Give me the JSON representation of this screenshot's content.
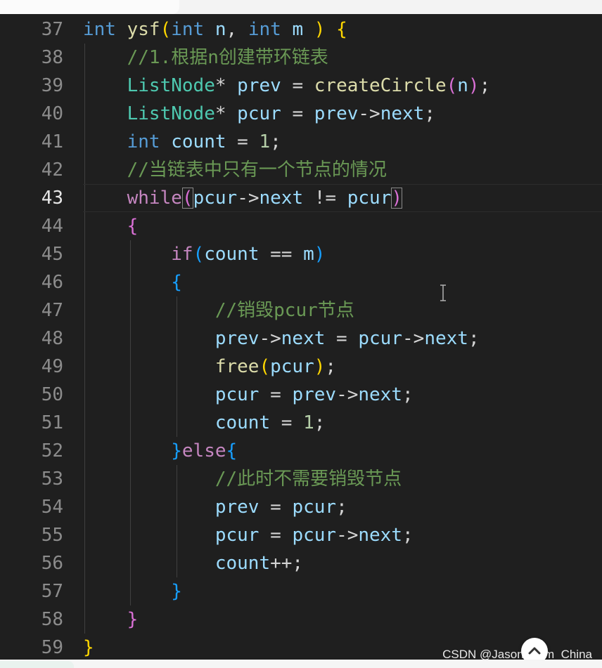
{
  "editor": {
    "lines": [
      {
        "number": "37",
        "tokens": [
          {
            "t": "int",
            "c": "kw"
          },
          {
            "t": " ",
            "c": "pn"
          },
          {
            "t": "ysf",
            "c": "fn"
          },
          {
            "t": "(",
            "c": "b1"
          },
          {
            "t": "int",
            "c": "kw"
          },
          {
            "t": " ",
            "c": "pn"
          },
          {
            "t": "n",
            "c": "var"
          },
          {
            "t": ", ",
            "c": "pn"
          },
          {
            "t": "int",
            "c": "kw"
          },
          {
            "t": " ",
            "c": "pn"
          },
          {
            "t": "m",
            "c": "var"
          },
          {
            "t": " ",
            "c": "pn"
          },
          {
            "t": ")",
            "c": "b1"
          },
          {
            "t": " ",
            "c": "pn"
          },
          {
            "t": "{",
            "c": "b1"
          }
        ]
      },
      {
        "number": "38",
        "tokens": [
          {
            "t": "    ",
            "c": "pn"
          },
          {
            "t": "//1.根据n创建带环链表",
            "c": "cmt"
          }
        ]
      },
      {
        "number": "39",
        "tokens": [
          {
            "t": "    ",
            "c": "pn"
          },
          {
            "t": "ListNode",
            "c": "type"
          },
          {
            "t": "* ",
            "c": "pn"
          },
          {
            "t": "prev",
            "c": "var"
          },
          {
            "t": " = ",
            "c": "pn"
          },
          {
            "t": "createCircle",
            "c": "fn"
          },
          {
            "t": "(",
            "c": "b2"
          },
          {
            "t": "n",
            "c": "var"
          },
          {
            "t": ")",
            "c": "b2"
          },
          {
            "t": ";",
            "c": "pn"
          }
        ]
      },
      {
        "number": "40",
        "tokens": [
          {
            "t": "    ",
            "c": "pn"
          },
          {
            "t": "ListNode",
            "c": "type"
          },
          {
            "t": "* ",
            "c": "pn"
          },
          {
            "t": "pcur",
            "c": "var"
          },
          {
            "t": " = ",
            "c": "pn"
          },
          {
            "t": "prev",
            "c": "var"
          },
          {
            "t": "->",
            "c": "pn"
          },
          {
            "t": "next",
            "c": "var"
          },
          {
            "t": ";",
            "c": "pn"
          }
        ]
      },
      {
        "number": "41",
        "tokens": [
          {
            "t": "    ",
            "c": "pn"
          },
          {
            "t": "int",
            "c": "kw"
          },
          {
            "t": " ",
            "c": "pn"
          },
          {
            "t": "count",
            "c": "var"
          },
          {
            "t": " = ",
            "c": "pn"
          },
          {
            "t": "1",
            "c": "num"
          },
          {
            "t": ";",
            "c": "pn"
          }
        ]
      },
      {
        "number": "42",
        "tokens": [
          {
            "t": "    ",
            "c": "pn"
          },
          {
            "t": "//当链表中只有一个节点的情况",
            "c": "cmt"
          }
        ]
      },
      {
        "number": "43",
        "active": true,
        "tokens": [
          {
            "t": "    ",
            "c": "pn"
          },
          {
            "t": "while",
            "c": "ctl"
          },
          {
            "t": "(",
            "c": "b2",
            "box": true
          },
          {
            "t": "pcur",
            "c": "var"
          },
          {
            "t": "->",
            "c": "pn"
          },
          {
            "t": "next",
            "c": "var"
          },
          {
            "t": " != ",
            "c": "pn"
          },
          {
            "t": "pcur",
            "c": "var"
          },
          {
            "t": ")",
            "c": "b2",
            "box": true
          }
        ]
      },
      {
        "number": "44",
        "tokens": [
          {
            "t": "    ",
            "c": "pn"
          },
          {
            "t": "{",
            "c": "b2"
          }
        ]
      },
      {
        "number": "45",
        "tokens": [
          {
            "t": "        ",
            "c": "pn"
          },
          {
            "t": "if",
            "c": "ctl"
          },
          {
            "t": "(",
            "c": "b3"
          },
          {
            "t": "count",
            "c": "var"
          },
          {
            "t": " == ",
            "c": "pn"
          },
          {
            "t": "m",
            "c": "var"
          },
          {
            "t": ")",
            "c": "b3"
          }
        ]
      },
      {
        "number": "46",
        "tokens": [
          {
            "t": "        ",
            "c": "pn"
          },
          {
            "t": "{",
            "c": "b3"
          }
        ]
      },
      {
        "number": "47",
        "tokens": [
          {
            "t": "            ",
            "c": "pn"
          },
          {
            "t": "//销毁pcur节点",
            "c": "cmt"
          }
        ]
      },
      {
        "number": "48",
        "tokens": [
          {
            "t": "            ",
            "c": "pn"
          },
          {
            "t": "prev",
            "c": "var"
          },
          {
            "t": "->",
            "c": "pn"
          },
          {
            "t": "next",
            "c": "var"
          },
          {
            "t": " = ",
            "c": "pn"
          },
          {
            "t": "pcur",
            "c": "var"
          },
          {
            "t": "->",
            "c": "pn"
          },
          {
            "t": "next",
            "c": "var"
          },
          {
            "t": ";",
            "c": "pn"
          }
        ]
      },
      {
        "number": "49",
        "tokens": [
          {
            "t": "            ",
            "c": "pn"
          },
          {
            "t": "free",
            "c": "fn"
          },
          {
            "t": "(",
            "c": "b1"
          },
          {
            "t": "pcur",
            "c": "var"
          },
          {
            "t": ")",
            "c": "b1"
          },
          {
            "t": ";",
            "c": "pn"
          }
        ]
      },
      {
        "number": "50",
        "tokens": [
          {
            "t": "            ",
            "c": "pn"
          },
          {
            "t": "pcur",
            "c": "var"
          },
          {
            "t": " = ",
            "c": "pn"
          },
          {
            "t": "prev",
            "c": "var"
          },
          {
            "t": "->",
            "c": "pn"
          },
          {
            "t": "next",
            "c": "var"
          },
          {
            "t": ";",
            "c": "pn"
          }
        ]
      },
      {
        "number": "51",
        "tokens": [
          {
            "t": "            ",
            "c": "pn"
          },
          {
            "t": "count",
            "c": "var"
          },
          {
            "t": " = ",
            "c": "pn"
          },
          {
            "t": "1",
            "c": "num"
          },
          {
            "t": ";",
            "c": "pn"
          }
        ]
      },
      {
        "number": "52",
        "tokens": [
          {
            "t": "        ",
            "c": "pn"
          },
          {
            "t": "}",
            "c": "b3"
          },
          {
            "t": "else",
            "c": "ctl"
          },
          {
            "t": "{",
            "c": "b3"
          }
        ]
      },
      {
        "number": "53",
        "tokens": [
          {
            "t": "            ",
            "c": "pn"
          },
          {
            "t": "//此时不需要销毁节点",
            "c": "cmt"
          }
        ]
      },
      {
        "number": "54",
        "tokens": [
          {
            "t": "            ",
            "c": "pn"
          },
          {
            "t": "prev",
            "c": "var"
          },
          {
            "t": " = ",
            "c": "pn"
          },
          {
            "t": "pcur",
            "c": "var"
          },
          {
            "t": ";",
            "c": "pn"
          }
        ]
      },
      {
        "number": "55",
        "tokens": [
          {
            "t": "            ",
            "c": "pn"
          },
          {
            "t": "pcur",
            "c": "var"
          },
          {
            "t": " = ",
            "c": "pn"
          },
          {
            "t": "pcur",
            "c": "var"
          },
          {
            "t": "->",
            "c": "pn"
          },
          {
            "t": "next",
            "c": "var"
          },
          {
            "t": ";",
            "c": "pn"
          }
        ]
      },
      {
        "number": "56",
        "tokens": [
          {
            "t": "            ",
            "c": "pn"
          },
          {
            "t": "count",
            "c": "var"
          },
          {
            "t": "++;",
            "c": "pn"
          }
        ]
      },
      {
        "number": "57",
        "tokens": [
          {
            "t": "        ",
            "c": "pn"
          },
          {
            "t": "}",
            "c": "b3"
          }
        ]
      },
      {
        "number": "58",
        "tokens": [
          {
            "t": "    ",
            "c": "pn"
          },
          {
            "t": "}",
            "c": "b2"
          }
        ]
      },
      {
        "number": "59",
        "tokens": [
          {
            "t": "}",
            "c": "b1"
          }
        ]
      }
    ]
  },
  "watermark": "CSDN @Jason_from_China",
  "colors": {
    "background": "#1f1f1f",
    "keyword": "#569cd6",
    "control": "#c586c0",
    "type": "#4ec9b0",
    "function": "#dcdcaa",
    "variable": "#9cdcfe",
    "number": "#b5cea8",
    "comment": "#6a9955"
  },
  "icons": {
    "scroll_top": "chevron-up-icon",
    "text_cursor": "ibeam-cursor-icon"
  }
}
